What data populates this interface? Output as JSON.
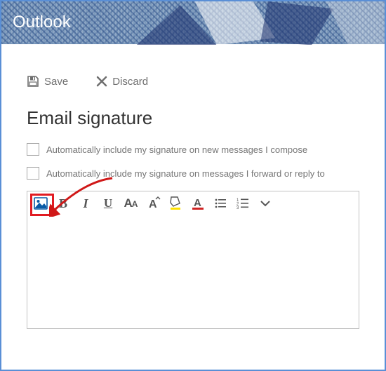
{
  "header": {
    "app_name": "Outlook"
  },
  "actions": {
    "save_label": "Save",
    "discard_label": "Discard"
  },
  "page": {
    "title": "Email signature"
  },
  "options": {
    "auto_new_label": "Automatically include my signature on new messages I compose",
    "auto_new_checked": false,
    "auto_reply_label": "Automatically include my signature on messages I forward or reply to",
    "auto_reply_checked": false
  },
  "editor": {
    "content": "",
    "toolbar": {
      "insert_image": "insert-image",
      "bold": "B",
      "italic": "I",
      "underline": "U",
      "font_size": "AA",
      "grow_font": "A",
      "highlight": "A",
      "font_color": "A",
      "bullets": "bulleted-list",
      "numbers": "numbered-list",
      "more": "more"
    }
  },
  "annotation": {
    "highlight_target": "insert-image-button",
    "arrow": "red arrow pointing to insert image button"
  }
}
